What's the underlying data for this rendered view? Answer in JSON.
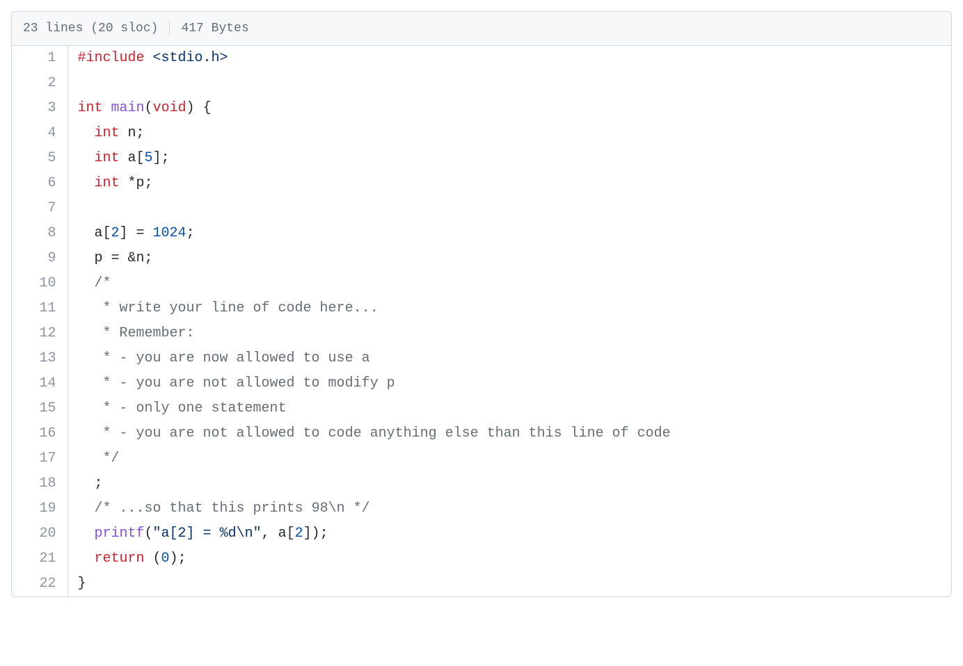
{
  "header": {
    "lines_text": "23 lines (20 sloc)",
    "size_text": "417 Bytes"
  },
  "code": {
    "lines": [
      {
        "num": "1",
        "tokens": [
          {
            "cls": "pl-k",
            "t": "#include"
          },
          {
            "cls": "",
            "t": " "
          },
          {
            "cls": "pl-s",
            "t": "<stdio.h>"
          }
        ]
      },
      {
        "num": "2",
        "tokens": []
      },
      {
        "num": "3",
        "tokens": [
          {
            "cls": "pl-k",
            "t": "int"
          },
          {
            "cls": "",
            "t": " "
          },
          {
            "cls": "pl-en",
            "t": "main"
          },
          {
            "cls": "",
            "t": "("
          },
          {
            "cls": "pl-k",
            "t": "void"
          },
          {
            "cls": "",
            "t": ") {"
          }
        ]
      },
      {
        "num": "4",
        "tokens": [
          {
            "cls": "",
            "t": "  "
          },
          {
            "cls": "pl-k",
            "t": "int"
          },
          {
            "cls": "",
            "t": " n;"
          }
        ]
      },
      {
        "num": "5",
        "tokens": [
          {
            "cls": "",
            "t": "  "
          },
          {
            "cls": "pl-k",
            "t": "int"
          },
          {
            "cls": "",
            "t": " a["
          },
          {
            "cls": "pl-c1",
            "t": "5"
          },
          {
            "cls": "",
            "t": "];"
          }
        ]
      },
      {
        "num": "6",
        "tokens": [
          {
            "cls": "",
            "t": "  "
          },
          {
            "cls": "pl-k",
            "t": "int"
          },
          {
            "cls": "",
            "t": " *p;"
          }
        ]
      },
      {
        "num": "7",
        "tokens": []
      },
      {
        "num": "8",
        "tokens": [
          {
            "cls": "",
            "t": "  a["
          },
          {
            "cls": "pl-c1",
            "t": "2"
          },
          {
            "cls": "",
            "t": "] = "
          },
          {
            "cls": "pl-c1",
            "t": "1024"
          },
          {
            "cls": "",
            "t": ";"
          }
        ]
      },
      {
        "num": "9",
        "tokens": [
          {
            "cls": "",
            "t": "  p = &n;"
          }
        ]
      },
      {
        "num": "10",
        "tokens": [
          {
            "cls": "",
            "t": "  "
          },
          {
            "cls": "pl-c",
            "t": "/*"
          }
        ]
      },
      {
        "num": "11",
        "tokens": [
          {
            "cls": "pl-c",
            "t": "   * write your line of code here..."
          }
        ]
      },
      {
        "num": "12",
        "tokens": [
          {
            "cls": "pl-c",
            "t": "   * Remember:"
          }
        ]
      },
      {
        "num": "13",
        "tokens": [
          {
            "cls": "pl-c",
            "t": "   * - you are now allowed to use a"
          }
        ]
      },
      {
        "num": "14",
        "tokens": [
          {
            "cls": "pl-c",
            "t": "   * - you are not allowed to modify p"
          }
        ]
      },
      {
        "num": "15",
        "tokens": [
          {
            "cls": "pl-c",
            "t": "   * - only one statement"
          }
        ]
      },
      {
        "num": "16",
        "tokens": [
          {
            "cls": "pl-c",
            "t": "   * - you are not allowed to code anything else than this line of code"
          }
        ]
      },
      {
        "num": "17",
        "tokens": [
          {
            "cls": "pl-c",
            "t": "   */"
          }
        ]
      },
      {
        "num": "18",
        "tokens": [
          {
            "cls": "",
            "t": "  ;"
          }
        ]
      },
      {
        "num": "19",
        "tokens": [
          {
            "cls": "",
            "t": "  "
          },
          {
            "cls": "pl-c",
            "t": "/* ...so that this prints 98\\n */"
          }
        ]
      },
      {
        "num": "20",
        "tokens": [
          {
            "cls": "",
            "t": "  "
          },
          {
            "cls": "pl-en",
            "t": "printf"
          },
          {
            "cls": "",
            "t": "("
          },
          {
            "cls": "pl-s",
            "t": "\"a[2] = %d\\n\""
          },
          {
            "cls": "",
            "t": ", a["
          },
          {
            "cls": "pl-c1",
            "t": "2"
          },
          {
            "cls": "",
            "t": "]);"
          }
        ]
      },
      {
        "num": "21",
        "tokens": [
          {
            "cls": "",
            "t": "  "
          },
          {
            "cls": "pl-k",
            "t": "return"
          },
          {
            "cls": "",
            "t": " ("
          },
          {
            "cls": "pl-c1",
            "t": "0"
          },
          {
            "cls": "",
            "t": ");"
          }
        ]
      },
      {
        "num": "22",
        "tokens": [
          {
            "cls": "",
            "t": "}"
          }
        ]
      }
    ]
  }
}
